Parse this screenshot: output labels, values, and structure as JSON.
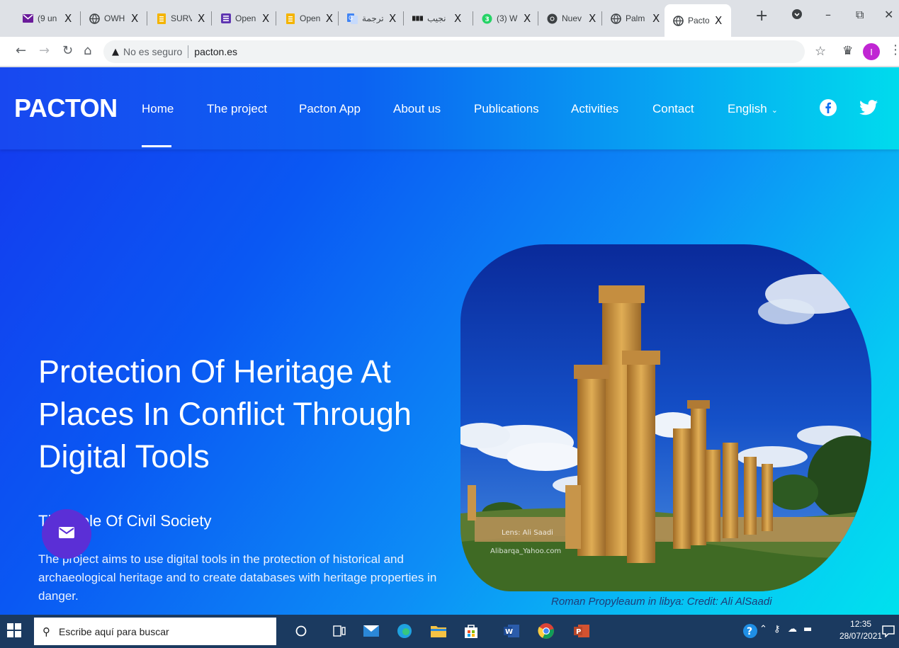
{
  "browser": {
    "tabs": [
      {
        "title": "(9 un",
        "icon": "gmail-icon"
      },
      {
        "title": "OWH",
        "icon": "globe-icon"
      },
      {
        "title": "SURV",
        "icon": "forms-icon"
      },
      {
        "title": "Open",
        "icon": "sheets-icon"
      },
      {
        "title": "Open",
        "icon": "forms-icon"
      },
      {
        "title": "ترجمة",
        "icon": "translate-icon"
      },
      {
        "title": "نجيب",
        "icon": "bbc-icon"
      },
      {
        "title": "(3) W",
        "icon": "whatsapp-icon"
      },
      {
        "title": "Nuev",
        "icon": "chrome-icon"
      },
      {
        "title": "Palm",
        "icon": "globe-icon"
      },
      {
        "title": "Pacto",
        "icon": "globe-icon",
        "active": true
      }
    ],
    "close_glyph": "X",
    "new_tab": "+",
    "security_label": "No es seguro",
    "url": "pacton.es",
    "profile_initial": "I"
  },
  "site": {
    "logo": "PACTON",
    "nav": [
      {
        "label": "Home"
      },
      {
        "label": "The project"
      },
      {
        "label": "Pacton App"
      },
      {
        "label": "About us"
      },
      {
        "label": "Publications"
      },
      {
        "label": "Activities"
      },
      {
        "label": "Contact"
      },
      {
        "label": "English"
      }
    ],
    "hero": {
      "title": "Protection Of Heritage At Places In Conflict Through Digital Tools",
      "subtitle": "The Role Of Civil Society",
      "description": "The project aims to use digital tools in the protection of historical and archaeological heritage and to create databases with heritage properties in danger.",
      "image_watermark_1": "Lens: Ali Saadi",
      "image_watermark_2": "Alibarqa_Yahoo.com",
      "caption": "Roman Propyleaum in libya: Credit: Ali AlSaadi"
    }
  },
  "taskbar": {
    "search_placeholder": "Escribe aquí para buscar",
    "time": "12:35",
    "date": "28/07/2021"
  }
}
